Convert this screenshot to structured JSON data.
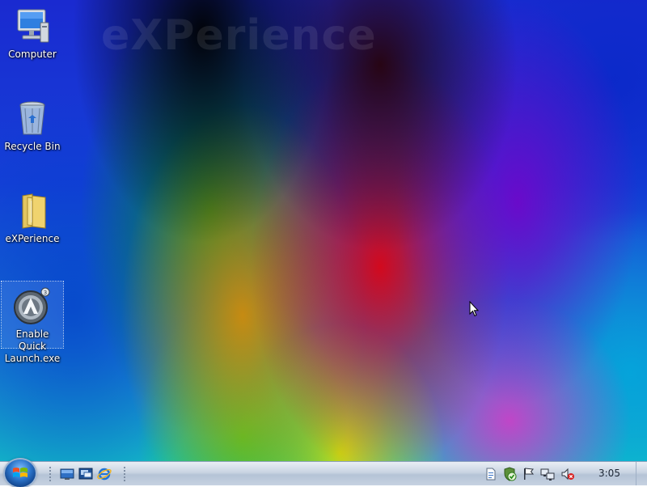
{
  "wallpaper": {
    "watermark_text": "eXPerience"
  },
  "desktop_icons": [
    {
      "label": "Computer",
      "icon": "computer-icon"
    },
    {
      "label": "Recycle Bin",
      "icon": "recycle-bin-icon"
    },
    {
      "label": "eXPerience",
      "icon": "folder-icon"
    },
    {
      "label": "Enable Quick\nLaunch.exe",
      "icon": "launcher-app-icon",
      "selected": true
    }
  ],
  "taskbar": {
    "start_button": {
      "icon": "windows-logo-icon"
    },
    "quick_launch": [
      {
        "icon": "show-desktop-icon"
      },
      {
        "icon": "switch-windows-icon"
      },
      {
        "icon": "internet-explorer-icon"
      }
    ],
    "tray": {
      "icons": [
        "document-icon",
        "security-shield-icon",
        "action-center-flag-icon",
        "network-icon",
        "volume-muted-icon"
      ],
      "clock": "3:05"
    }
  },
  "colors": {
    "taskbar_top": "#e9eef5",
    "taskbar_bottom": "#b5c3d6",
    "start_orb": "#2b73c9"
  }
}
